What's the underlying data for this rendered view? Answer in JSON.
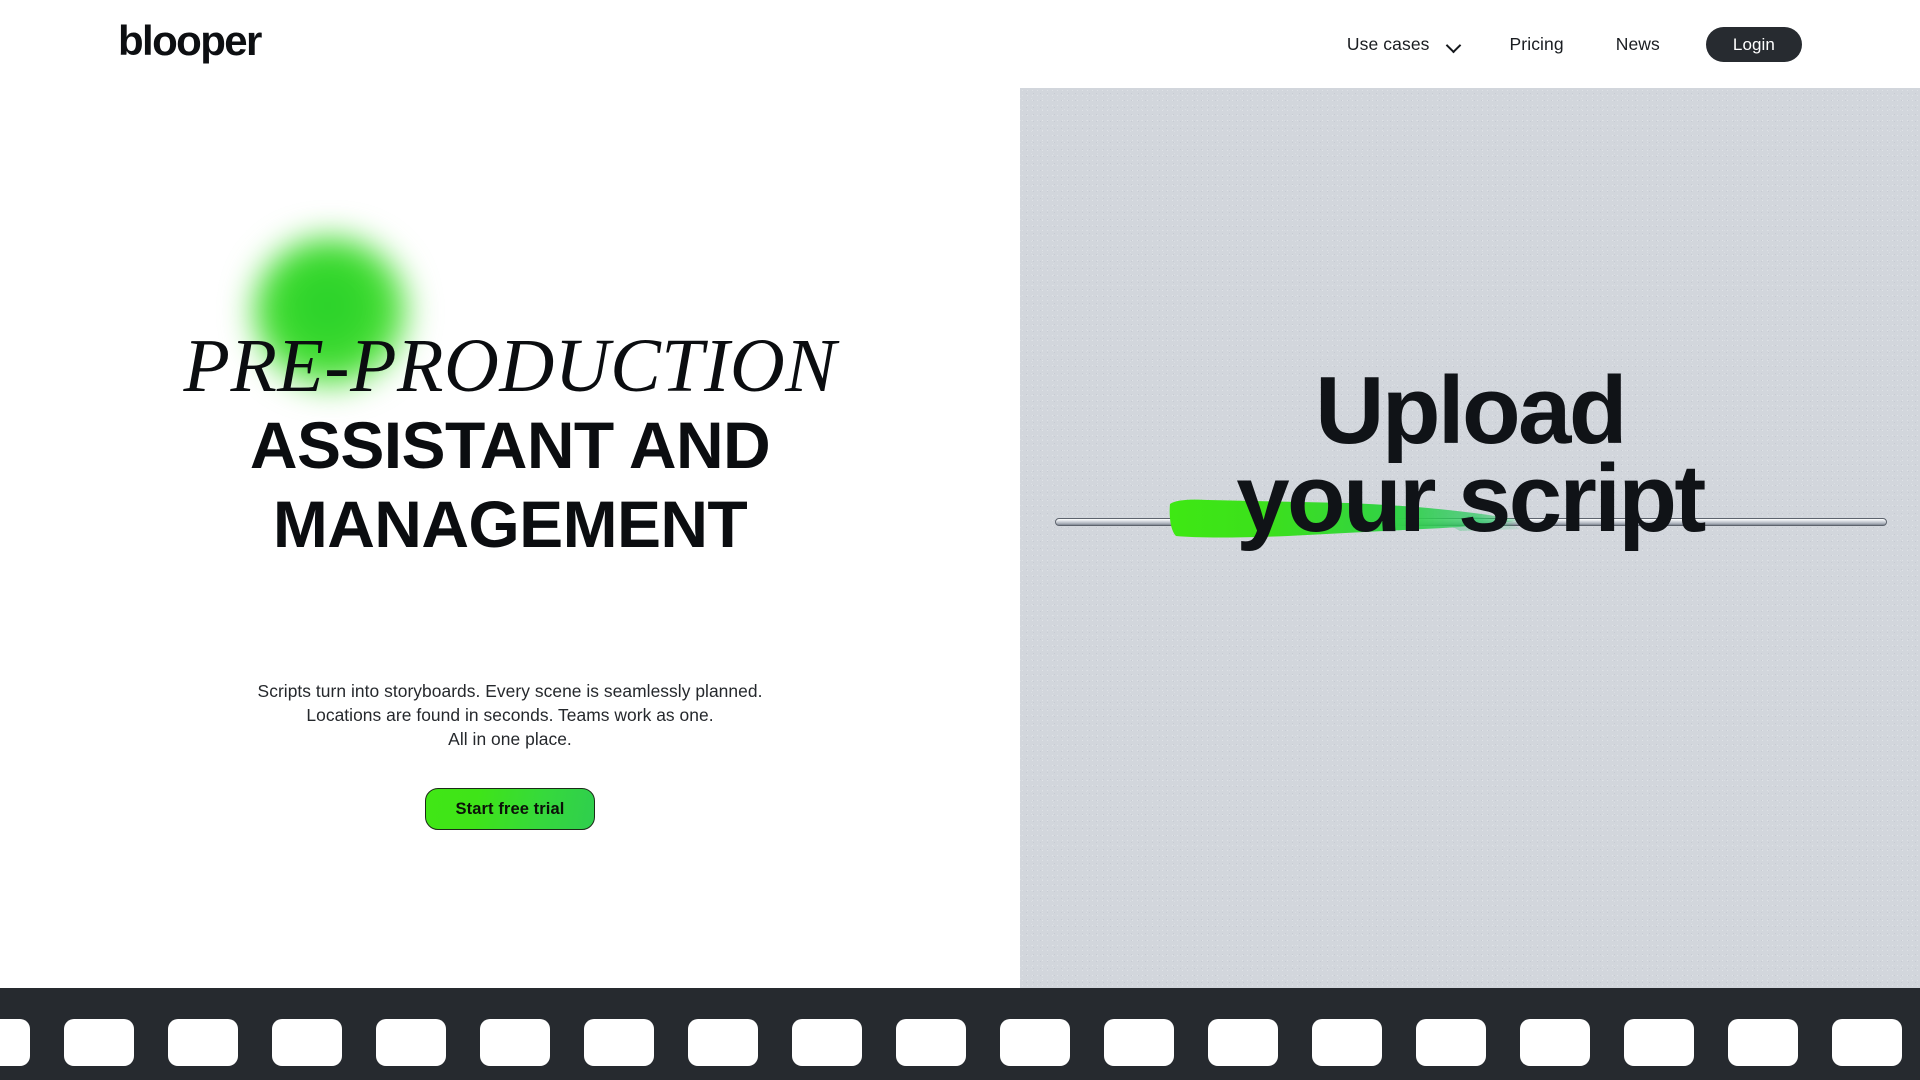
{
  "brand": {
    "name": "blooper"
  },
  "nav": {
    "use_cases": {
      "label": "Use cases",
      "icon": "chevron-down-icon"
    },
    "pricing": {
      "label": "Pricing"
    },
    "news": {
      "label": "News"
    },
    "login": {
      "label": "Login"
    }
  },
  "hero": {
    "headline_serif": "PRE-PRODUCTION",
    "headline_line1": "ASSISTANT AND",
    "headline_line2": "MANAGEMENT",
    "subtitle_line1": "Scripts turn into storyboards. Every scene is seamlessly planned.",
    "subtitle_line2": "Locations are found in seconds. Teams work as one.",
    "subtitle_line3": "All in one place.",
    "cta_label": "Start free trial"
  },
  "panel": {
    "title_line1": "Upload",
    "title_line2": "your script"
  },
  "colors": {
    "accent_green_bright": "#41e616",
    "accent_green_deep": "#2ec46a",
    "brand_dark": "#262a2f",
    "panel_bg": "#d2d6dc",
    "page_bg": "#ffffff",
    "text_dark": "#0b0d10"
  },
  "film_strip": {
    "hole_count": 19
  }
}
